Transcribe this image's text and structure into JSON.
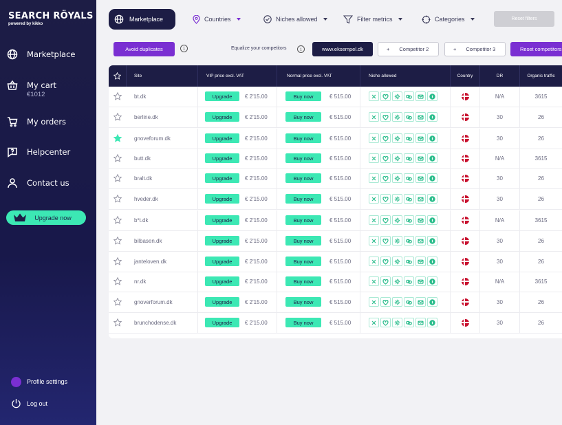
{
  "brand": {
    "name_part1": "SEARCH R",
    "name_part2": "YALS",
    "tagline": "powered by kikko"
  },
  "sidebar": {
    "items": [
      {
        "label": "Marketplace",
        "icon": "globe-icon"
      },
      {
        "label": "My cart",
        "sub": "€1012",
        "icon": "basket-icon"
      },
      {
        "label": "My orders",
        "icon": "cart-icon"
      },
      {
        "label": "Helpcenter",
        "icon": "help-icon"
      },
      {
        "label": "Contact  us",
        "icon": "user-icon"
      }
    ],
    "upgrade_label": "Upgrade now",
    "profile_label": "Profile settings",
    "logout_label": "Log out"
  },
  "filters": {
    "marketplace": "Marketplace",
    "countries": "Countries",
    "niches": "Niches allowed",
    "metrics": "Filter metrics",
    "categories": "Categories",
    "reset": "Reset filters"
  },
  "competitors": {
    "avoid_label": "Avoid duplicates",
    "equalize_label": "Equalize your competitors",
    "domain_value": "www.eksempel.dk",
    "competitor2": "Competitor 2",
    "competitor3": "Competitor 3",
    "plus": "+",
    "reset_label": "Reset competitors",
    "info": "i"
  },
  "table": {
    "headers": {
      "site": "Site",
      "vip": "VIP price excl. VAT",
      "normal": "Normal price excl. VAT",
      "niche": "Niche allowed",
      "country": "Country",
      "dr": "DR",
      "traffic": "Organic traffic"
    },
    "upgrade_label": "Upgrade",
    "buy_label": "Buy now",
    "niche_icons": [
      "close-icon",
      "heart-icon",
      "gear-icon",
      "link-icon",
      "mail-icon",
      "coin-icon"
    ],
    "rows": [
      {
        "site": "bt.dk",
        "vip": "€ 2'15.00",
        "normal": "€ 515.00",
        "dr": "N/A",
        "traffic": "3615",
        "starred": false
      },
      {
        "site": "berline.dk",
        "vip": "€ 2'15.00",
        "normal": "€ 515.00",
        "dr": "30",
        "traffic": "26",
        "starred": false
      },
      {
        "site": "gnoveforum.dk",
        "vip": "€ 2'15.00",
        "normal": "€ 515.00",
        "dr": "30",
        "traffic": "26",
        "starred": true
      },
      {
        "site": "butt.dk",
        "vip": "€ 2'15.00",
        "normal": "€ 515.00",
        "dr": "N/A",
        "traffic": "3615",
        "starred": false
      },
      {
        "site": "bralt.dk",
        "vip": "€ 2'15.00",
        "normal": "€ 515.00",
        "dr": "30",
        "traffic": "26",
        "starred": false
      },
      {
        "site": "hveder.dk",
        "vip": "€ 2'15.00",
        "normal": "€ 515.00",
        "dr": "30",
        "traffic": "26",
        "starred": false
      },
      {
        "site": "b*t.dk",
        "vip": "€ 2'15.00",
        "normal": "€ 515.00",
        "dr": "N/A",
        "traffic": "3615",
        "starred": false
      },
      {
        "site": "bilbasen.dk",
        "vip": "€ 2'15.00",
        "normal": "€ 515.00",
        "dr": "30",
        "traffic": "26",
        "starred": false
      },
      {
        "site": "janteloven.dk",
        "vip": "€ 2'15.00",
        "normal": "€ 515.00",
        "dr": "30",
        "traffic": "26",
        "starred": false
      },
      {
        "site": "nr.dk",
        "vip": "€ 2'15.00",
        "normal": "€ 515.00",
        "dr": "N/A",
        "traffic": "3615",
        "starred": false
      },
      {
        "site": "gnoverforum.dk",
        "vip": "€ 2'15.00",
        "normal": "€ 515.00",
        "dr": "30",
        "traffic": "26",
        "starred": false
      },
      {
        "site": "brunchodense.dk",
        "vip": "€ 2'15.00",
        "normal": "€ 515.00",
        "dr": "30",
        "traffic": "26",
        "starred": false
      }
    ]
  },
  "colors": {
    "navy": "#1d1d45",
    "purple": "#7a2fd2",
    "mint": "#3ce8b4",
    "star_active": "#3ce8b4"
  }
}
